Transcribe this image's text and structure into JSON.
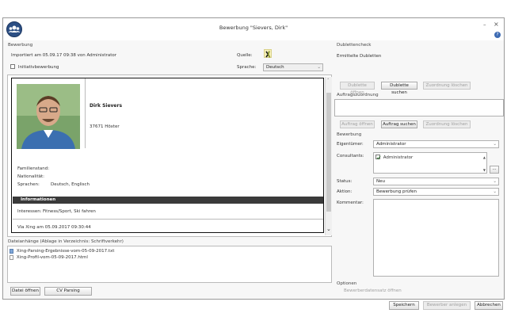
{
  "window": {
    "title": "Bewerbung \"Sievers, Dirk\"",
    "controls": {
      "minimize": "–",
      "close": "×",
      "help": "?"
    }
  },
  "left": {
    "section_bewerbung": "Bewerbung",
    "imported_text": "Importiert am 05.09.17 09:38 von Administrator",
    "initiativ_label": "Initiativbewerbung",
    "quelle_label": "Quelle:",
    "sprache_label": "Sprache:",
    "sprache_value": "Deutsch",
    "profile": {
      "name": "Dirk Sievers",
      "city": "37671 Höxter",
      "familienstand_label": "Familienstand:",
      "nationalitaet_label": "Nationalität:",
      "sprachen_label": "Sprachen:",
      "sprachen_value": "Deutsch, Englisch",
      "info_header": "Informationen",
      "interessen_label": "Interessen:",
      "interessen_value": "Fitness/Sport, Ski fahren",
      "via_text": "Via Xing am 05.09.2017 09:30:44"
    },
    "attachments": {
      "header": "Dateianhänge (Ablage in Verzeichnis: Schriftverkehr)",
      "files": [
        "Xing-Parsing-Ergebnisse-vom-05-09-2017.txt",
        "Xing-Profil-vom-05-09-2017.html"
      ]
    },
    "buttons": {
      "open_file": "Datei öffnen",
      "cv_parsing": "CV Parsing"
    }
  },
  "right": {
    "dublettencheck": "Dublettencheck",
    "ermittelte_dubletten": "Ermittelte Dubletten",
    "dublette_oeffnen": "Dublette öffnen",
    "dublette_suchen": "Dublette suchen",
    "zuordnung_loeschen": "Zuordnung löschen",
    "auftragszuordnung": "Auftragszuordnung",
    "auftrag_oeffnen": "Auftrag öffnen",
    "auftrag_suchen": "Auftrag suchen",
    "zuordnung_loeschen2": "Zuordnung löschen",
    "bewerbung": "Bewerbung",
    "eigentuemer_label": "Eigentümer:",
    "eigentuemer_value": "Administrator",
    "consultants_label": "Consultants:",
    "consultant_value": "Administrator",
    "consultant_add": "...",
    "status_label": "Status:",
    "status_value": "Neu",
    "aktion_label": "Aktion:",
    "aktion_value": "Bewerbung prüfen",
    "kommentar_label": "Kommentar:",
    "optionen": "Optionen",
    "bewerberdatensatz": "Bewerberdatensatz öffnen",
    "speichern": "Speichern",
    "bewerber_anlegen": "Bewerber anlegen",
    "abbrechen": "Abbrechen"
  },
  "colors": {
    "app_icon": "#2c4f84",
    "info_bar": "#3a3a3a"
  }
}
